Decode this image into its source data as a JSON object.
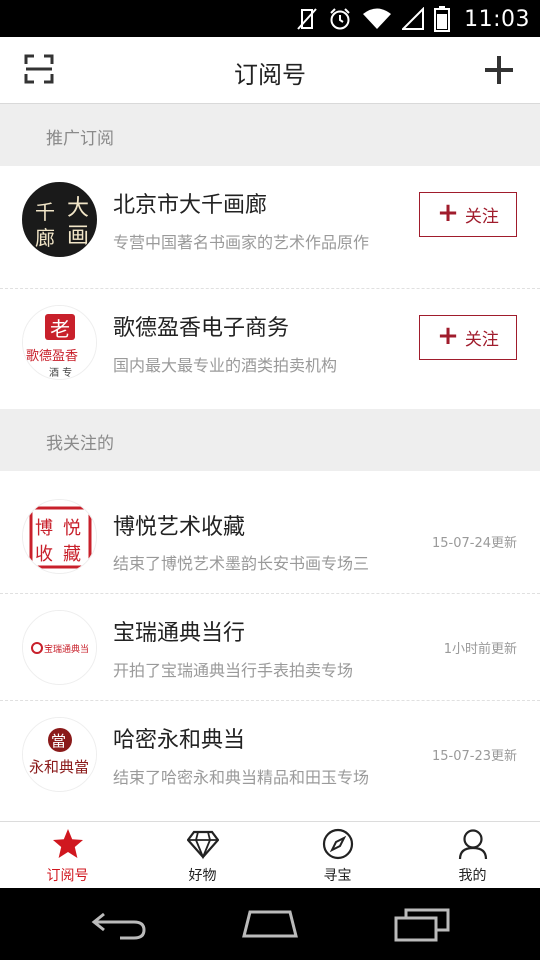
{
  "status_bar": {
    "time": "11:03"
  },
  "header": {
    "title": "订阅号"
  },
  "sections": {
    "promoted": "推广订阅",
    "following": "我关注的"
  },
  "promoted_items": [
    {
      "name": "北京市大千画廊",
      "desc": "专营中国著名书画家的艺术作品原作",
      "follow_label": "关注",
      "logo_text": "大千画廊"
    },
    {
      "name": "歌德盈香电子商务",
      "desc": "国内最大最专业的酒类拍卖机构",
      "follow_label": "关注",
      "logo_text": "歌德盈香"
    }
  ],
  "followed_items": [
    {
      "name": "博悦艺术收藏",
      "desc": "结束了博悦艺术墨韵长安书画专场三",
      "updated": "15-07-24更新",
      "logo_text": "博悦"
    },
    {
      "name": "宝瑞通典当行",
      "desc": "开拍了宝瑞通典当行手表拍卖专场",
      "updated": "1小时前更新",
      "logo_text": "宝瑞通典当行"
    },
    {
      "name": "哈密永和典当",
      "desc": "结束了哈密永和典当精品和田玉专场",
      "updated": "15-07-23更新",
      "logo_text": "永和典当"
    }
  ],
  "tabs": [
    {
      "label": "订阅号",
      "icon": "star-icon",
      "active": true
    },
    {
      "label": "好物",
      "icon": "diamond-icon",
      "active": false
    },
    {
      "label": "寻宝",
      "icon": "compass-icon",
      "active": false
    },
    {
      "label": "我的",
      "icon": "person-icon",
      "active": false
    }
  ],
  "colors": {
    "accent": "#d0171f",
    "follow_border": "#a01c2c"
  }
}
